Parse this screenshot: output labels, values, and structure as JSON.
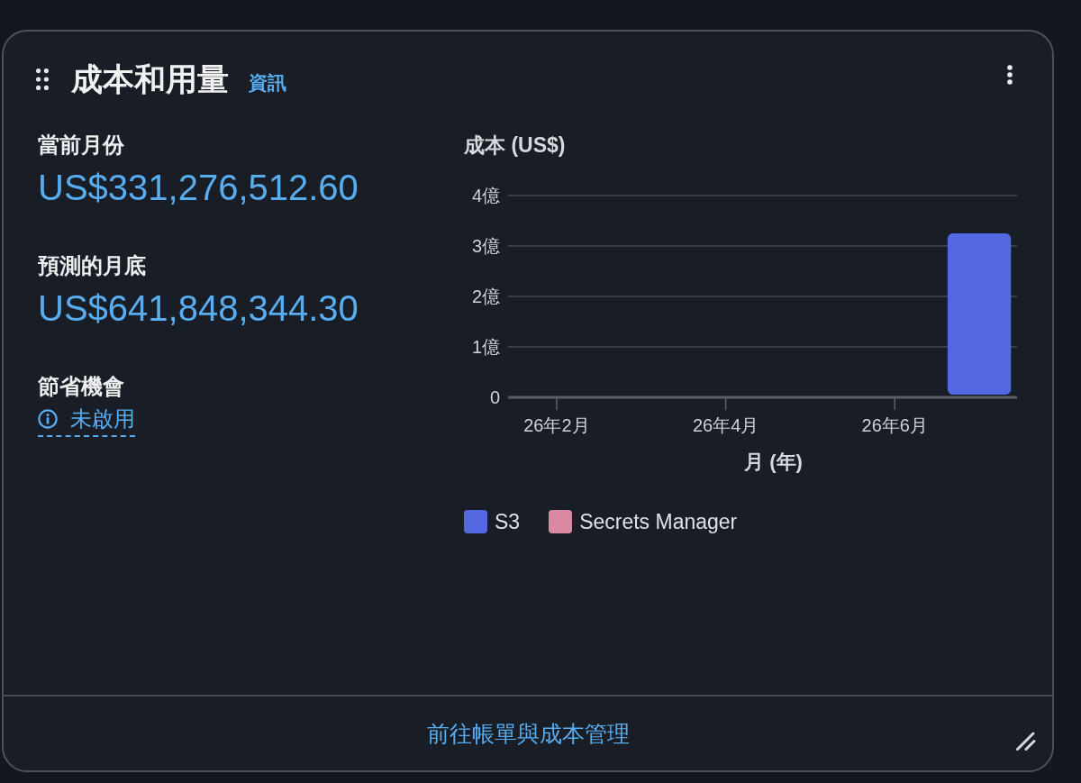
{
  "widget": {
    "title": "成本和用量",
    "info_link": "資訊",
    "metrics": [
      {
        "label": "當前月份",
        "value": "US$331,276,512.60"
      },
      {
        "label": "預測的月底",
        "value": "US$641,848,344.30"
      }
    ],
    "savings": {
      "label": "節省機會",
      "status": "未啟用"
    },
    "chart": {
      "chart_data": {
        "type": "bar",
        "ylabel": "成本 (US$)",
        "xlabel": "月 (年)",
        "categories": [
          "26年2月",
          null,
          "26年4月",
          null,
          "26年6月",
          null
        ],
        "ylim": [
          0,
          4
        ],
        "yticks": [
          0,
          {
            "value": 1,
            "label": "1億"
          },
          {
            "value": 2,
            "label": "2億"
          },
          {
            "value": 3,
            "label": "3億"
          },
          {
            "value": 4,
            "label": "4億"
          }
        ],
        "grid": true,
        "stacked": true,
        "series": [
          {
            "name": "S3",
            "color": "#5469e1",
            "values": [
              0,
              0,
              0,
              0,
              0,
              3.25
            ]
          },
          {
            "name": "Secrets Manager",
            "color": "#d98aa2",
            "values": [
              0,
              0,
              0,
              0,
              0,
              0
            ]
          }
        ]
      }
    },
    "footer_link": "前往帳單與成本管理"
  }
}
